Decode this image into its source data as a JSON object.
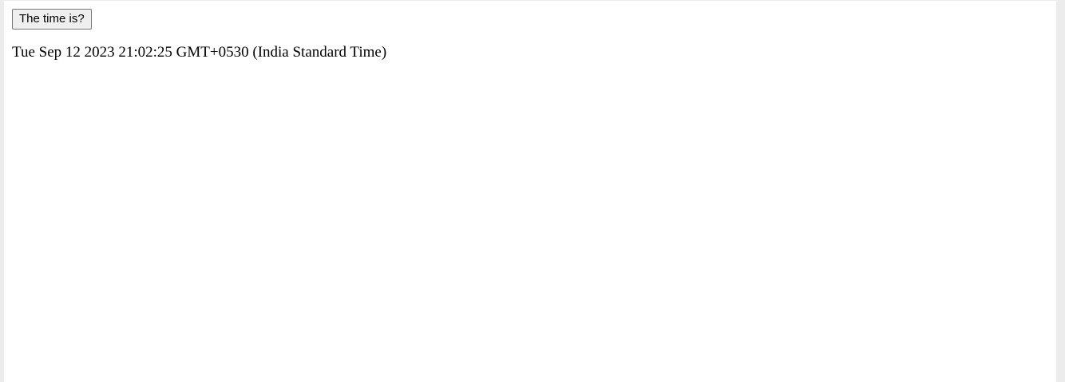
{
  "page": {
    "button_label": "The time is?",
    "time_output": "Tue Sep 12 2023 21:02:25 GMT+0530 (India Standard Time)"
  }
}
